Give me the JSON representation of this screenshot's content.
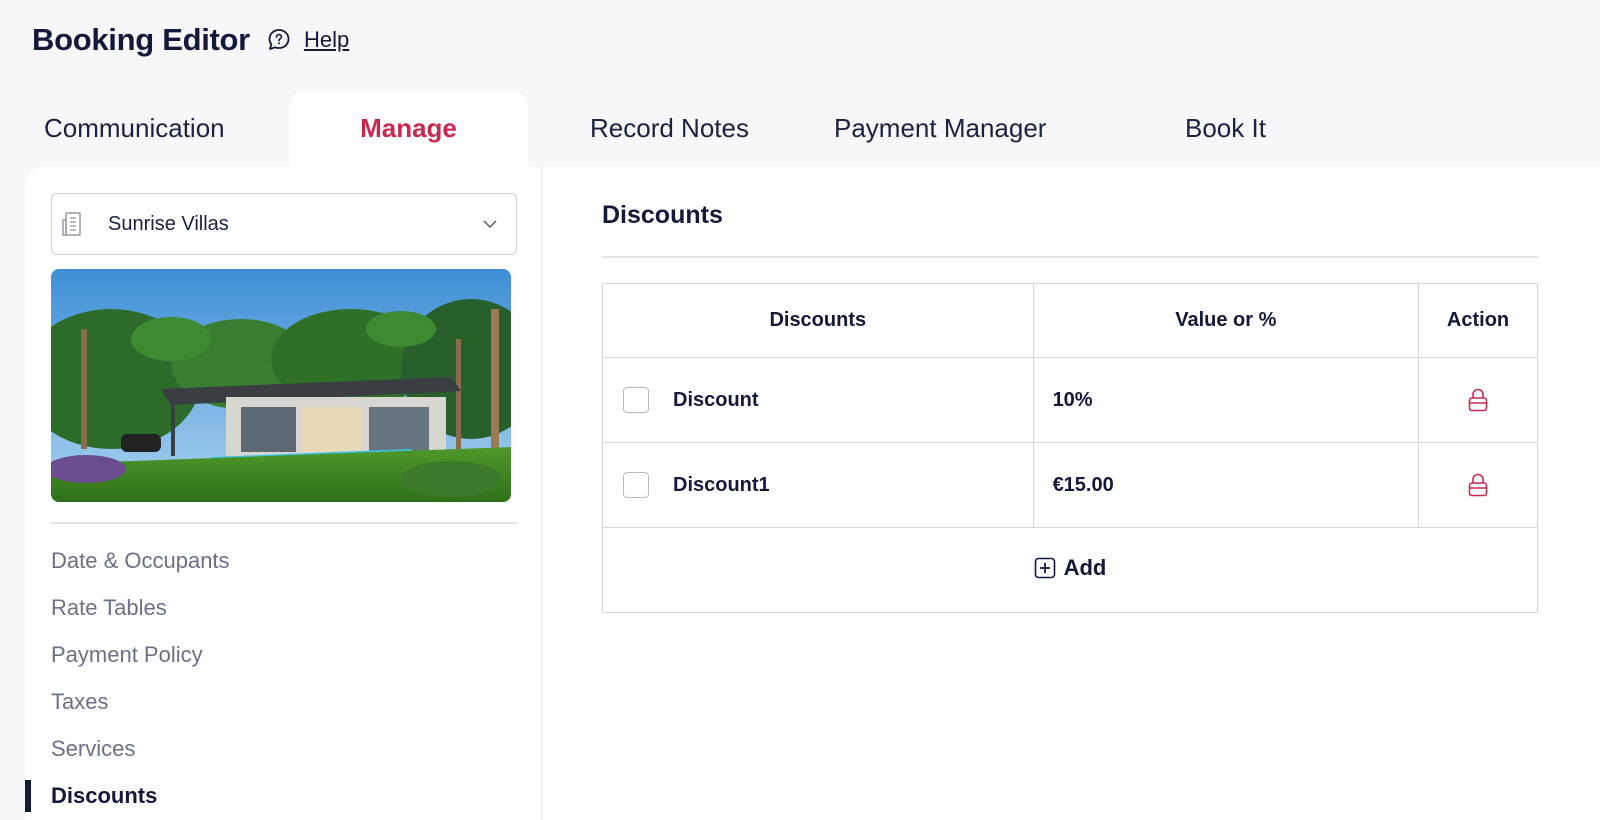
{
  "header": {
    "title": "Booking Editor",
    "help_label": "Help"
  },
  "tabs": [
    {
      "label": "Communication"
    },
    {
      "label": "Manage"
    },
    {
      "label": "Record Notes"
    },
    {
      "label": "Payment Manager"
    },
    {
      "label": "Book It"
    }
  ],
  "sidebar": {
    "property": "Sunrise Villas",
    "nav": [
      {
        "label": "Date & Occupants"
      },
      {
        "label": "Rate Tables"
      },
      {
        "label": "Payment Policy"
      },
      {
        "label": "Taxes"
      },
      {
        "label": "Services"
      },
      {
        "label": "Discounts"
      }
    ]
  },
  "main": {
    "title": "Discounts",
    "table": {
      "headers": [
        "Discounts",
        "Value or %",
        "Action"
      ],
      "rows": [
        {
          "name": "Discount",
          "value": "10%"
        },
        {
          "name": "Discount1",
          "value": "€15.00"
        }
      ],
      "add_label": "Add"
    }
  },
  "colors": {
    "accent": "#c8294f",
    "text": "#14193a",
    "muted": "#6b7086"
  }
}
